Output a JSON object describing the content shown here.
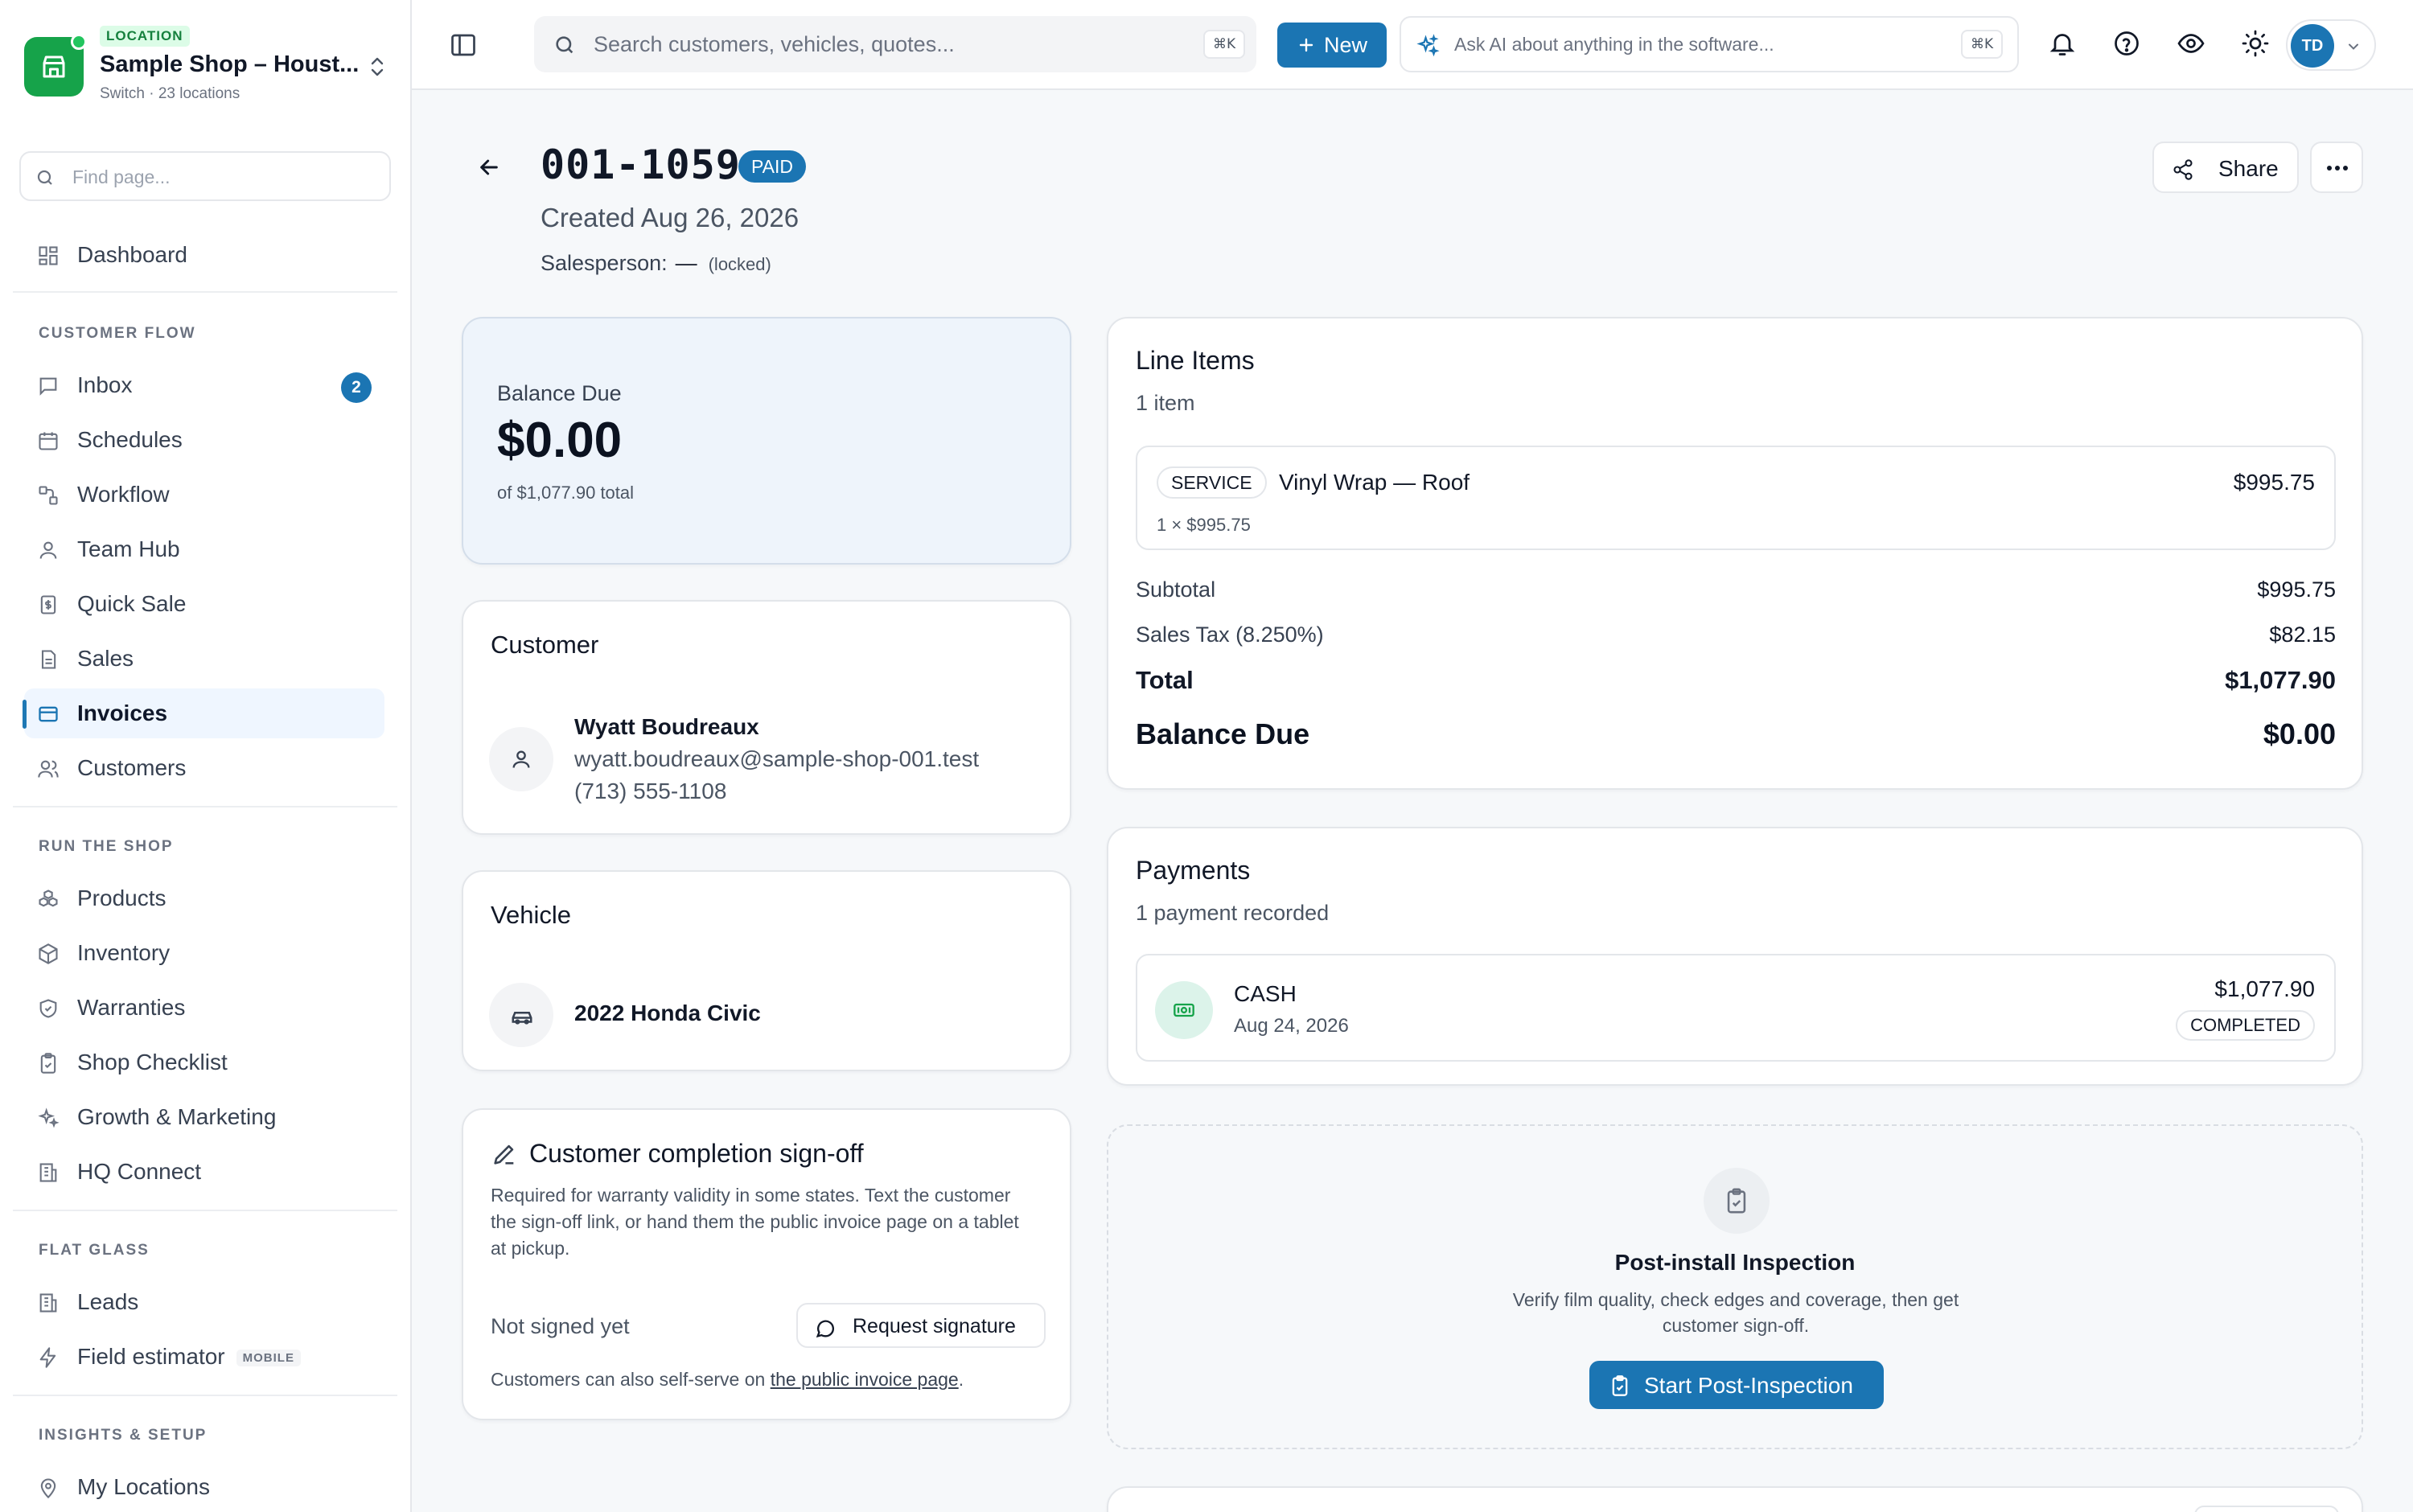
{
  "location": {
    "badge": "LOCATION",
    "name": "Sample Shop – Houst...",
    "sub": "Switch · 23 locations",
    "accent": "#16a34a"
  },
  "sidebar": {
    "find_placeholder": "Find page...",
    "dashboard": "Dashboard",
    "sections": {
      "customer_flow": "CUSTOMER FLOW",
      "run_the_shop": "RUN THE SHOP",
      "flat_glass": "FLAT GLASS",
      "insights": "INSIGHTS & SETUP"
    },
    "items": {
      "inbox": "Inbox",
      "inbox_badge": "2",
      "schedules": "Schedules",
      "workflow": "Workflow",
      "team_hub": "Team Hub",
      "quick_sale": "Quick Sale",
      "sales": "Sales",
      "invoices": "Invoices",
      "customers": "Customers",
      "products": "Products",
      "inventory": "Inventory",
      "warranties": "Warranties",
      "shop_checklist": "Shop Checklist",
      "growth": "Growth & Marketing",
      "hq_connect": "HQ Connect",
      "leads": "Leads",
      "field_estimator": "Field estimator",
      "mobile_tag": "MOBILE",
      "my_locations": "My Locations"
    },
    "active": "invoices"
  },
  "topbar": {
    "search_placeholder": "Search customers, vehicles, quotes...",
    "search_kbd": "⌘K",
    "new_label": "New",
    "ask_ai": "Ask AI about anything in the software...",
    "ask_kbd": "⌘K",
    "avatar": "TD",
    "brand_color": "#1b75b3"
  },
  "header": {
    "invoice_number": "001-1059",
    "status": "PAID",
    "created": "Created Aug 26, 2026",
    "salesperson_label": "Salesperson:",
    "salesperson_value": "—",
    "salesperson_note": "(locked)",
    "share_label": "Share"
  },
  "balance": {
    "label": "Balance Due",
    "amount": "$0.00",
    "of_total": "of $1,077.90 total"
  },
  "customer": {
    "title": "Customer",
    "name": "Wyatt Boudreaux",
    "email": "wyatt.boudreaux@sample-shop-001.test",
    "phone": "(713) 555-1108"
  },
  "vehicle": {
    "title": "Vehicle",
    "name": "2022 Honda Civic"
  },
  "signoff": {
    "title": "Customer completion sign-off",
    "description": "Required for warranty validity in some states. Text the customer the sign-off link, or hand them the public invoice page on a tablet at pickup.",
    "status": "Not signed yet",
    "request_button": "Request signature",
    "self_serve_prefix": "Customers can also self-serve on ",
    "self_serve_link": "the public invoice page",
    "self_serve_suffix": "."
  },
  "line_items": {
    "title": "Line Items",
    "count": "1 item",
    "items": [
      {
        "type": "SERVICE",
        "name": "Vinyl Wrap — Roof",
        "price": "$995.75",
        "qty_line": "1 × $995.75"
      }
    ],
    "subtotal_label": "Subtotal",
    "subtotal": "$995.75",
    "tax_label": "Sales Tax (8.250%)",
    "tax": "$82.15",
    "total_label": "Total",
    "total": "$1,077.90",
    "balance_label": "Balance Due",
    "balance": "$0.00"
  },
  "payments": {
    "title": "Payments",
    "count": "1 payment recorded",
    "items": [
      {
        "method": "CASH",
        "date": "Aug 24, 2026",
        "amount": "$1,077.90",
        "status": "COMPLETED"
      }
    ]
  },
  "inspection": {
    "title": "Post-install Inspection",
    "description": "Verify film quality, check edges and coverage, then get customer sign-off.",
    "button": "Start Post-Inspection"
  }
}
